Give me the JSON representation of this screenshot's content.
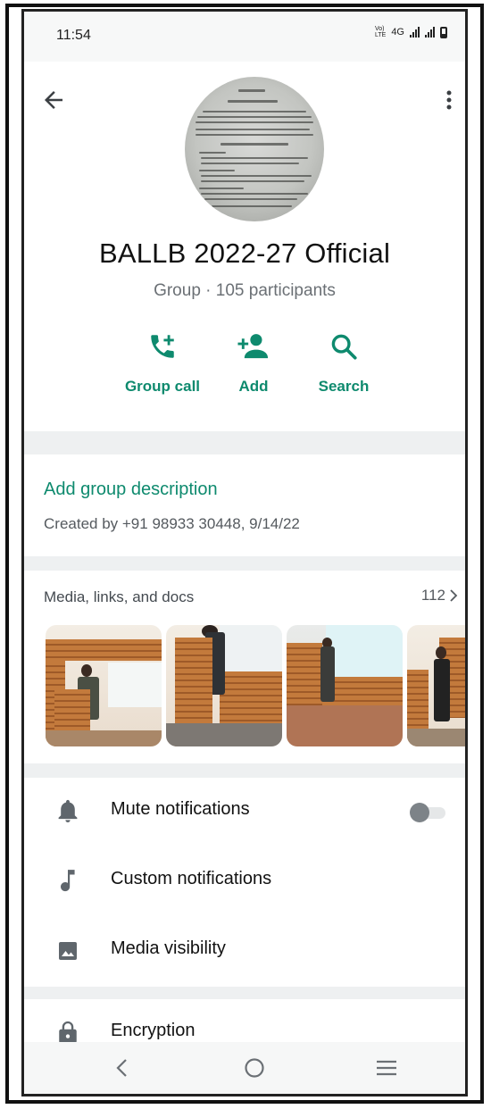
{
  "status_bar": {
    "time": "11:54",
    "network": "4G"
  },
  "header": {
    "back_icon": "arrow-left-icon",
    "menu_icon": "more-vertical-icon",
    "avatar": "document-photo",
    "title": "BALLB 2022-27 Official",
    "subtitle": "Group · 105 participants"
  },
  "actions": [
    {
      "label": "Group call",
      "icon": "call-add-icon"
    },
    {
      "label": "Add",
      "icon": "person-add-icon"
    },
    {
      "label": "Search",
      "icon": "search-icon"
    }
  ],
  "description": {
    "add_label": "Add group description",
    "created_text": "Created by +91 98933 30448, 9/14/22"
  },
  "media": {
    "title": "Media, links, and docs",
    "count": "112",
    "thumbnails": [
      "photo-1",
      "photo-2",
      "photo-3",
      "photo-4"
    ]
  },
  "settings": [
    {
      "label": "Mute notifications",
      "icon": "bell-icon",
      "toggle": false
    },
    {
      "label": "Custom notifications",
      "icon": "music-note-icon"
    },
    {
      "label": "Media visibility",
      "icon": "image-icon"
    },
    {
      "label": "Encryption",
      "icon": "lock-icon"
    }
  ],
  "colors": {
    "accent": "#0e8a6e",
    "divider": "#eef0f1"
  },
  "nav": [
    "back-icon",
    "home-icon",
    "recents-icon"
  ]
}
